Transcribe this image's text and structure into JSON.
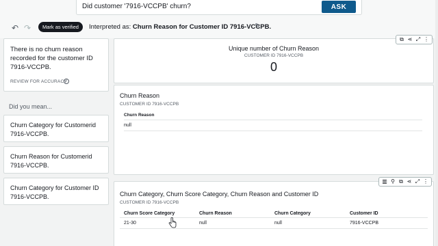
{
  "query": {
    "text": "Did customer '7916-VCCPB' churn?",
    "ask_label": "ASK"
  },
  "toolbar": {
    "verify_label": "Mark as verified",
    "interpreted_prefix": "Interpreted as:",
    "interpreted_value": "Churn Reason for Customer ID 7916-VCCPB."
  },
  "answer": {
    "text": "There is no churn reason recorded for the customer ID 7916-VCCPB.",
    "review_label": "REVIEW FOR ACCURACY"
  },
  "suggestions": {
    "heading": "Did you mean...",
    "items": [
      {
        "label": "Churn Category for Customerid 7916-VCCPB."
      },
      {
        "label": "Churn Reason for Customerid 7916-VCCPB."
      },
      {
        "label": "Churn Category for Customer ID 7916-VCCPB."
      }
    ]
  },
  "kpi": {
    "title": "Unique number of Churn Reason",
    "subtitle": "CUSTOMER ID 7916-VCCPB",
    "value": "0"
  },
  "reason_table": {
    "title": "Churn Reason",
    "subtitle": "CUSTOMER ID 7916-VCCPB",
    "column": "Churn Reason",
    "value": "null"
  },
  "detail_table": {
    "title": "Churn Category, Churn Score Category, Churn Reason and Customer ID",
    "subtitle": "CUSTOMER ID 7916-VCCPB",
    "columns": [
      "Churn Score Category",
      "Churn Reason",
      "Churn Category",
      "Customer ID"
    ],
    "row": [
      "21-30",
      "null",
      "null",
      "7916-VCCPB"
    ]
  },
  "icons": {
    "visual_actions_1": [
      "share-external-icon",
      "share-icon",
      "expand-icon",
      "more-icon"
    ],
    "visual_actions_2": [
      "chart-icon",
      "pin-icon",
      "share-external-icon",
      "share-icon",
      "expand-icon",
      "more-icon"
    ]
  }
}
